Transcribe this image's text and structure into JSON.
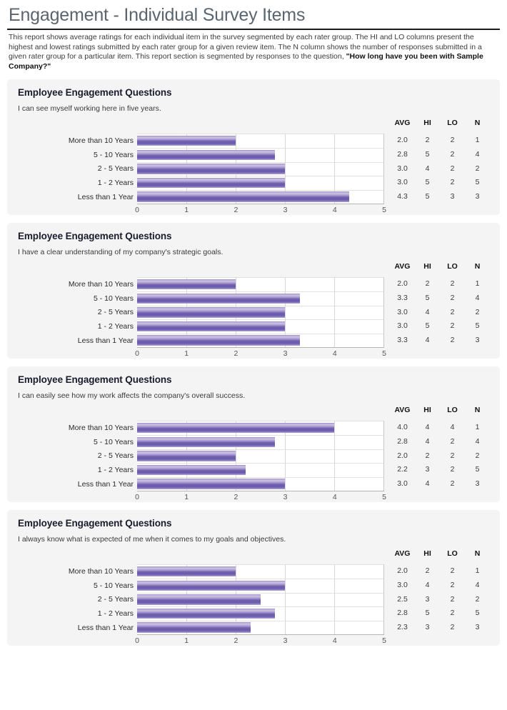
{
  "header": {
    "title": "Engagement - Individual Survey Items",
    "intro_text": "This report shows average ratings for each individual item in the survey segmented by each rater group. The HI and LO columns present the highest and lowest ratings submitted by each rater group for a given review item. The N column shows the number of responses submitted in a given rater group for a particular item. This report section is segmented by responses to the question,",
    "intro_question": "\"How long have you been with Sample Company?\""
  },
  "stats_columns": [
    "AVG",
    "HI",
    "LO",
    "N"
  ],
  "axis_ticks": [
    "0",
    "1",
    "2",
    "3",
    "4",
    "5"
  ],
  "colors": {
    "bar_light": "#cdc2e3",
    "bar_dark": "#6a5aab",
    "card_bg": "#f4f4f4",
    "title": "#5a6570"
  },
  "chart_data": [
    {
      "type": "bar",
      "title": "Employee Engagement Questions",
      "subtitle": "I can see myself working here in five years.",
      "orientation": "horizontal",
      "xlabel": "",
      "ylabel": "",
      "xlim": [
        0,
        5
      ],
      "xticks": [
        0,
        1,
        2,
        3,
        4,
        5
      ],
      "grid": true,
      "legend": "none",
      "categories": [
        "More than 10 Years",
        "5 - 10 Years",
        "2 - 5 Years",
        "1 - 2 Years",
        "Less than 1 Year"
      ],
      "values": [
        2.0,
        2.8,
        3.0,
        3.0,
        4.3
      ],
      "rows": [
        {
          "label": "More than 10 Years",
          "avg": "2.0",
          "value": 2.0,
          "hi": "2",
          "lo": "2",
          "n": "1"
        },
        {
          "label": "5 - 10 Years",
          "avg": "2.8",
          "value": 2.8,
          "hi": "5",
          "lo": "2",
          "n": "4"
        },
        {
          "label": "2 - 5 Years",
          "avg": "3.0",
          "value": 3.0,
          "hi": "4",
          "lo": "2",
          "n": "2"
        },
        {
          "label": "1 - 2 Years",
          "avg": "3.0",
          "value": 3.0,
          "hi": "5",
          "lo": "2",
          "n": "5"
        },
        {
          "label": "Less than 1 Year",
          "avg": "4.3",
          "value": 4.3,
          "hi": "5",
          "lo": "3",
          "n": "3"
        }
      ]
    },
    {
      "type": "bar",
      "title": "Employee Engagement Questions",
      "subtitle": "I have a clear understanding of my company's strategic goals.",
      "orientation": "horizontal",
      "xlabel": "",
      "ylabel": "",
      "xlim": [
        0,
        5
      ],
      "xticks": [
        0,
        1,
        2,
        3,
        4,
        5
      ],
      "grid": true,
      "legend": "none",
      "categories": [
        "More than 10 Years",
        "5 - 10 Years",
        "2 - 5 Years",
        "1 - 2 Years",
        "Less than 1 Year"
      ],
      "values": [
        2.0,
        3.3,
        3.0,
        3.0,
        3.3
      ],
      "rows": [
        {
          "label": "More than 10 Years",
          "avg": "2.0",
          "value": 2.0,
          "hi": "2",
          "lo": "2",
          "n": "1"
        },
        {
          "label": "5 - 10 Years",
          "avg": "3.3",
          "value": 3.3,
          "hi": "5",
          "lo": "2",
          "n": "4"
        },
        {
          "label": "2 - 5 Years",
          "avg": "3.0",
          "value": 3.0,
          "hi": "4",
          "lo": "2",
          "n": "2"
        },
        {
          "label": "1 - 2 Years",
          "avg": "3.0",
          "value": 3.0,
          "hi": "5",
          "lo": "2",
          "n": "5"
        },
        {
          "label": "Less than 1 Year",
          "avg": "3.3",
          "value": 3.3,
          "hi": "4",
          "lo": "2",
          "n": "3"
        }
      ]
    },
    {
      "type": "bar",
      "title": "Employee Engagement Questions",
      "subtitle": "I can easily see how my work affects the company's overall success.",
      "orientation": "horizontal",
      "xlabel": "",
      "ylabel": "",
      "xlim": [
        0,
        5
      ],
      "xticks": [
        0,
        1,
        2,
        3,
        4,
        5
      ],
      "grid": true,
      "legend": "none",
      "categories": [
        "More than 10 Years",
        "5 - 10 Years",
        "2 - 5 Years",
        "1 - 2 Years",
        "Less than 1 Year"
      ],
      "values": [
        4.0,
        2.8,
        2.0,
        2.2,
        3.0
      ],
      "rows": [
        {
          "label": "More than 10 Years",
          "avg": "4.0",
          "value": 4.0,
          "hi": "4",
          "lo": "4",
          "n": "1"
        },
        {
          "label": "5 - 10 Years",
          "avg": "2.8",
          "value": 2.8,
          "hi": "4",
          "lo": "2",
          "n": "4"
        },
        {
          "label": "2 - 5 Years",
          "avg": "2.0",
          "value": 2.0,
          "hi": "2",
          "lo": "2",
          "n": "2"
        },
        {
          "label": "1 - 2 Years",
          "avg": "2.2",
          "value": 2.2,
          "hi": "3",
          "lo": "2",
          "n": "5"
        },
        {
          "label": "Less than 1 Year",
          "avg": "3.0",
          "value": 3.0,
          "hi": "4",
          "lo": "2",
          "n": "3"
        }
      ]
    },
    {
      "type": "bar",
      "title": "Employee Engagement Questions",
      "subtitle": "I always know what is expected of me when it comes to my goals and objectives.",
      "orientation": "horizontal",
      "xlabel": "",
      "ylabel": "",
      "xlim": [
        0,
        5
      ],
      "xticks": [
        0,
        1,
        2,
        3,
        4,
        5
      ],
      "grid": true,
      "legend": "none",
      "categories": [
        "More than 10 Years",
        "5 - 10 Years",
        "2 - 5 Years",
        "1 - 2 Years",
        "Less than 1 Year"
      ],
      "values": [
        2.0,
        3.0,
        2.5,
        2.8,
        2.3
      ],
      "rows": [
        {
          "label": "More than 10 Years",
          "avg": "2.0",
          "value": 2.0,
          "hi": "2",
          "lo": "2",
          "n": "1"
        },
        {
          "label": "5 - 10 Years",
          "avg": "3.0",
          "value": 3.0,
          "hi": "4",
          "lo": "2",
          "n": "4"
        },
        {
          "label": "2 - 5 Years",
          "avg": "2.5",
          "value": 2.5,
          "hi": "3",
          "lo": "2",
          "n": "2"
        },
        {
          "label": "1 - 2 Years",
          "avg": "2.8",
          "value": 2.8,
          "hi": "5",
          "lo": "2",
          "n": "5"
        },
        {
          "label": "Less than 1 Year",
          "avg": "2.3",
          "value": 2.3,
          "hi": "3",
          "lo": "2",
          "n": "3"
        }
      ]
    }
  ]
}
